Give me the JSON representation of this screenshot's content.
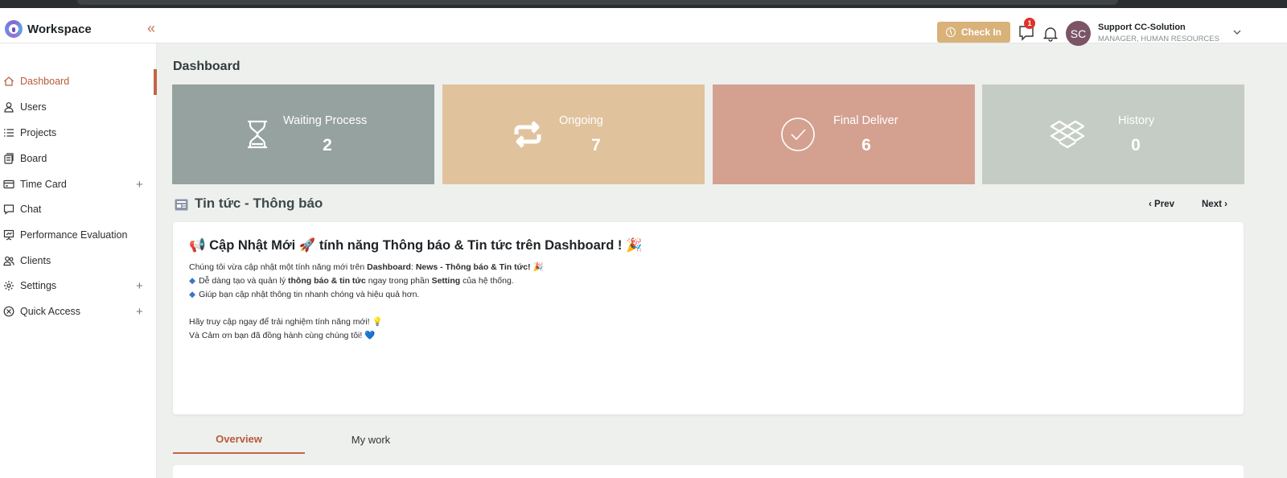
{
  "app": {
    "name": "Workspace",
    "collapse_glyph": "«"
  },
  "header": {
    "checkin_label": "Check In",
    "notification_count": "1",
    "user": {
      "initials": "SC",
      "name": "Support CC-Solution",
      "role": "MANAGER, HUMAN RESOURCES"
    }
  },
  "sidebar": {
    "items": [
      {
        "label": "Dashboard",
        "icon": "home-icon",
        "active": true
      },
      {
        "label": "Users",
        "icon": "user-icon"
      },
      {
        "label": "Projects",
        "icon": "list-icon"
      },
      {
        "label": "Board",
        "icon": "board-icon"
      },
      {
        "label": "Time Card",
        "icon": "card-icon",
        "expandable": true
      },
      {
        "label": "Chat",
        "icon": "chat-icon"
      },
      {
        "label": "Performance Evaluation",
        "icon": "presentation-icon"
      },
      {
        "label": "Clients",
        "icon": "clients-icon"
      },
      {
        "label": "Settings",
        "icon": "gear-icon",
        "expandable": true
      },
      {
        "label": "Quick Access",
        "icon": "quick-access-icon",
        "expandable": true
      }
    ],
    "plus_glyph": "+"
  },
  "page": {
    "title": "Dashboard"
  },
  "stats": [
    {
      "title": "Waiting Process",
      "value": "2",
      "icon": "hourglass-icon",
      "color": "#95a29f"
    },
    {
      "title": "Ongoing",
      "value": "7",
      "icon": "repeat-icon",
      "color": "#e0c29c"
    },
    {
      "title": "Final Deliver",
      "value": "6",
      "icon": "check-circle-icon",
      "color": "#d4a190"
    },
    {
      "title": "History",
      "value": "0",
      "icon": "dropbox-icon",
      "color": "#c4ccc5"
    }
  ],
  "news": {
    "section_title": "Tin tức - Thông báo",
    "prev_label": "Prev",
    "next_label": "Next",
    "headline": "📢 Cập Nhật Mới 🚀 tính năng Thông báo & Tin tức trên Dashboard ! 🎉",
    "intro_prefix": "Chúng tôi vừa cập nhật một tính năng mới trên ",
    "intro_bold_1": "Dashboard",
    "intro_mid": ": ",
    "intro_bold_2": "News - Thông báo & Tin tức!",
    "intro_suffix": " 🎉",
    "bullet_1_prefix": "Dễ dàng tạo và quản lý ",
    "bullet_1_bold": "thông báo & tin tức",
    "bullet_1_mid": " ngay trong phần ",
    "bullet_1_bold_2": "Setting",
    "bullet_1_suffix": " của hệ thống.",
    "bullet_2": "Giúp bạn cập nhật thông tin nhanh chóng và hiệu quả hơn.",
    "closing_1": "Hãy truy cập ngay để trải nghiệm tính năng mới! 💡",
    "closing_2": "Và Cảm ơn bạn đã đồng hành cùng chúng tôi! 💙"
  },
  "tabs": [
    {
      "label": "Overview",
      "active": true
    },
    {
      "label": "My work"
    }
  ],
  "colors": {
    "accent": "#c26547",
    "checkin": "#d9b27a",
    "avatar": "#7b5466"
  }
}
